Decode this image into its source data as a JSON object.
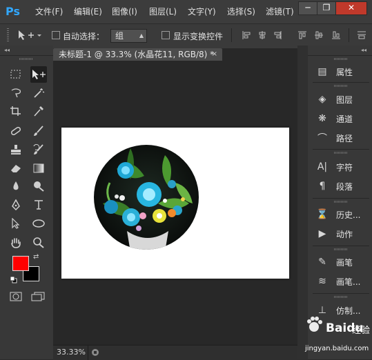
{
  "app": {
    "logo": "Ps"
  },
  "menu": [
    "文件(F)",
    "编辑(E)",
    "图像(I)",
    "图层(L)",
    "文字(Y)",
    "选择(S)",
    "滤镜(T)"
  ],
  "window_controls": {
    "minimize": "─",
    "restore": "❐",
    "close": "✕"
  },
  "options": {
    "auto_select_label": "自动选择：",
    "auto_select_value": "组",
    "show_transform_label": "显示变换控件"
  },
  "document": {
    "tab_title": "未标题-1 @ 33.3% (水晶花11, RGB/8) *",
    "close_glyph": "×",
    "zoom": "33.33%"
  },
  "panel_collapse": {
    "left": "◂◂",
    "right": "◂◂",
    "doc": "▸▸"
  },
  "right_panel": {
    "items": [
      {
        "label": "属性",
        "icon": "properties-icon"
      },
      {
        "label": "图层",
        "icon": "layers-icon"
      },
      {
        "label": "通道",
        "icon": "channels-icon"
      },
      {
        "label": "路径",
        "icon": "paths-icon"
      },
      {
        "label": "字符",
        "icon": "character-icon"
      },
      {
        "label": "段落",
        "icon": "paragraph-icon"
      },
      {
        "label": "历史...",
        "icon": "history-icon"
      },
      {
        "label": "动作",
        "icon": "actions-icon"
      },
      {
        "label": "画笔",
        "icon": "brush-icon"
      },
      {
        "label": "画笔...",
        "icon": "brush-presets-icon"
      },
      {
        "label": "仿制...",
        "icon": "clone-source-icon"
      }
    ]
  },
  "colors": {
    "foreground": "#ff0000",
    "background": "#000000",
    "accent": "#31a8ff"
  },
  "watermark": {
    "brand": "Bai",
    "paw": "du",
    "suffix": "经验",
    "url": "jingyan.baidu.com"
  }
}
